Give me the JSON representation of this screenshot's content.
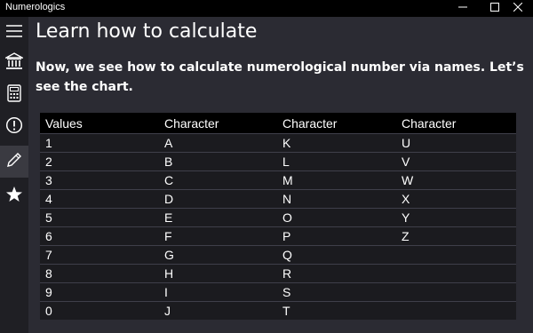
{
  "window": {
    "title": "Numerologics",
    "controls": {
      "minimize": "—",
      "maximize": "☐",
      "close": "✕"
    }
  },
  "sidebar": {
    "items": [
      {
        "icon": "hamburger-menu-icon"
      },
      {
        "icon": "bank-icon"
      },
      {
        "icon": "calculator-icon"
      },
      {
        "icon": "info-circle-icon"
      },
      {
        "icon": "pencil-icon",
        "active": true
      },
      {
        "icon": "star-icon"
      }
    ]
  },
  "page": {
    "title": "Learn how to calculate",
    "intro": "Now, we see how to calculate numerological number via names. Let’s see the chart."
  },
  "table": {
    "headers": [
      "Values",
      "Character",
      "Character",
      "Character"
    ],
    "rows": [
      [
        "1",
        "A",
        "K",
        "U"
      ],
      [
        "2",
        "B",
        "L",
        "V"
      ],
      [
        "3",
        "C",
        "M",
        "W"
      ],
      [
        "4",
        "D",
        "N",
        "X"
      ],
      [
        "5",
        "E",
        "O",
        "Y"
      ],
      [
        "6",
        "F",
        "P",
        "Z"
      ],
      [
        "7",
        "G",
        "Q",
        ""
      ],
      [
        "8",
        "H",
        "R",
        ""
      ],
      [
        "9",
        "I",
        "S",
        ""
      ],
      [
        "0",
        "J",
        "T",
        ""
      ]
    ]
  }
}
